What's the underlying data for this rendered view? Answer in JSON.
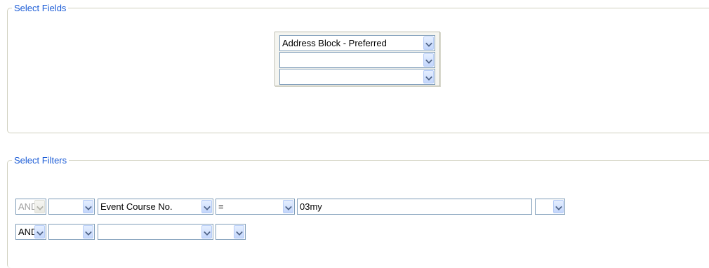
{
  "select_fields": {
    "legend": "Select Fields",
    "fields": [
      {
        "value": "Address Block - Preferred"
      },
      {
        "value": ""
      },
      {
        "value": ""
      }
    ]
  },
  "select_filters": {
    "legend": "Select Filters",
    "rows": [
      {
        "logic": "AND",
        "logic_disabled": true,
        "paren_open": "",
        "field": "Event Course No.",
        "operator": "=",
        "value": "03my",
        "paren_close": ""
      },
      {
        "logic": "AND",
        "logic_disabled": false,
        "paren_open": "",
        "field": "",
        "paren_close": ""
      }
    ]
  },
  "icons": {
    "dropdown": "chevron-down-icon"
  },
  "colors": {
    "legend": "#1a5bd6",
    "input_border": "#7f9db9",
    "group_border": "#d0d0bf"
  }
}
